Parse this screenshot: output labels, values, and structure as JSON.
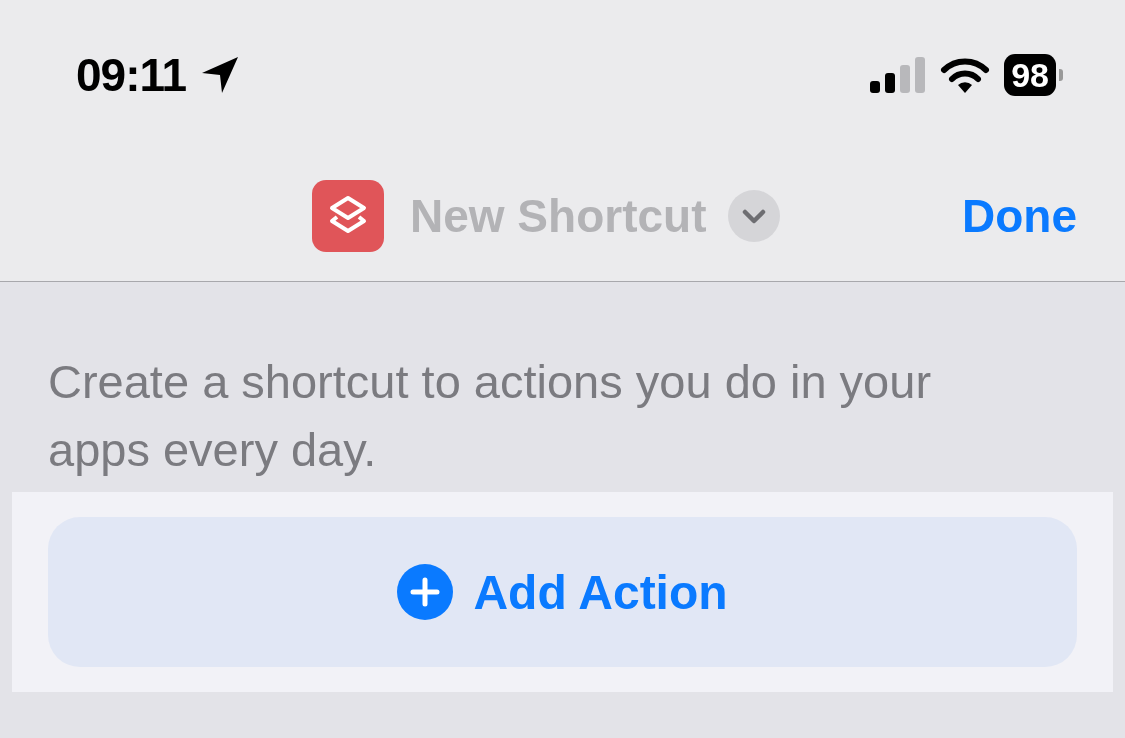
{
  "status_bar": {
    "time": "09:11",
    "battery": "98"
  },
  "nav_bar": {
    "title": "New Shortcut",
    "done": "Done"
  },
  "description": "Create a shortcut to actions you do in your apps every day.",
  "add_action": {
    "label": "Add Action"
  }
}
